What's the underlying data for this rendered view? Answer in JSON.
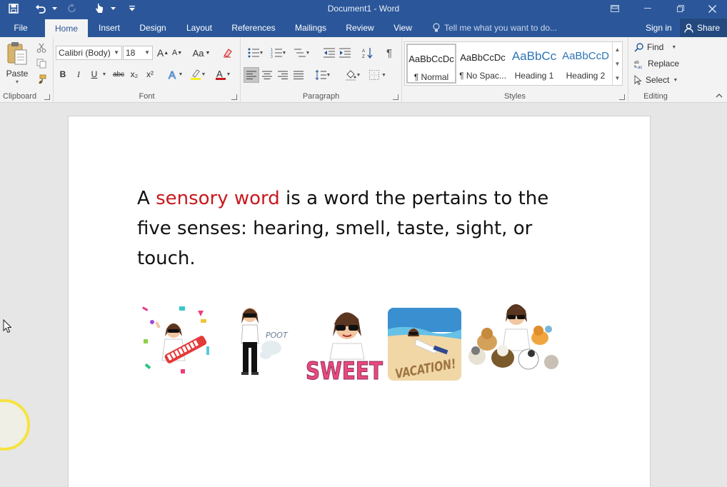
{
  "app": {
    "title": "Document1 - Word"
  },
  "tabs": [
    {
      "id": "file",
      "label": "File"
    },
    {
      "id": "home",
      "label": "Home",
      "active": true
    },
    {
      "id": "insert",
      "label": "Insert"
    },
    {
      "id": "design",
      "label": "Design"
    },
    {
      "id": "layout",
      "label": "Layout"
    },
    {
      "id": "references",
      "label": "References"
    },
    {
      "id": "mailings",
      "label": "Mailings"
    },
    {
      "id": "review",
      "label": "Review"
    },
    {
      "id": "view",
      "label": "View"
    }
  ],
  "tellme": {
    "placeholder": "Tell me what you want to do..."
  },
  "account": {
    "signin": "Sign in",
    "share": "Share"
  },
  "ribbon": {
    "clipboard": {
      "label": "Clipboard",
      "paste": "Paste"
    },
    "font": {
      "label": "Font",
      "family": "Calibri (Body)",
      "size": "18",
      "bold": "B",
      "italic": "I",
      "underline": "U",
      "strike": "abc",
      "sub": "x₂",
      "sup": "x²",
      "case": "Aa",
      "grow": "A",
      "shrink": "A"
    },
    "paragraph": {
      "label": "Paragraph"
    },
    "styles": {
      "label": "Styles",
      "items": [
        {
          "preview": "AaBbCcDc",
          "name": "¶ Normal",
          "selected": true
        },
        {
          "preview": "AaBbCcDc",
          "name": "¶ No Spac..."
        },
        {
          "preview": "AaBbCc",
          "name": "Heading 1"
        },
        {
          "preview": "AaBbCcD",
          "name": "Heading 2"
        }
      ]
    },
    "editing": {
      "label": "Editing",
      "find": "Find",
      "replace": "Replace",
      "select": "Select"
    }
  },
  "document": {
    "text_before": "A ",
    "highlight": "sensory word",
    "text_after": " is a word the pertains to the five senses: hearing, smell, taste, sight, or touch.",
    "images": [
      {
        "name": "keytar-bitmoji"
      },
      {
        "name": "poot-bitmoji",
        "caption": "POOT"
      },
      {
        "name": "sweet-bitmoji",
        "caption": "SWEET"
      },
      {
        "name": "vacation-bitmoji",
        "caption": "VACATION!"
      },
      {
        "name": "dogs-bitmoji"
      }
    ]
  },
  "colors": {
    "brand": "#2b579a",
    "highlight_text": "#c8191e",
    "cursor_ring": "#f5e342"
  }
}
